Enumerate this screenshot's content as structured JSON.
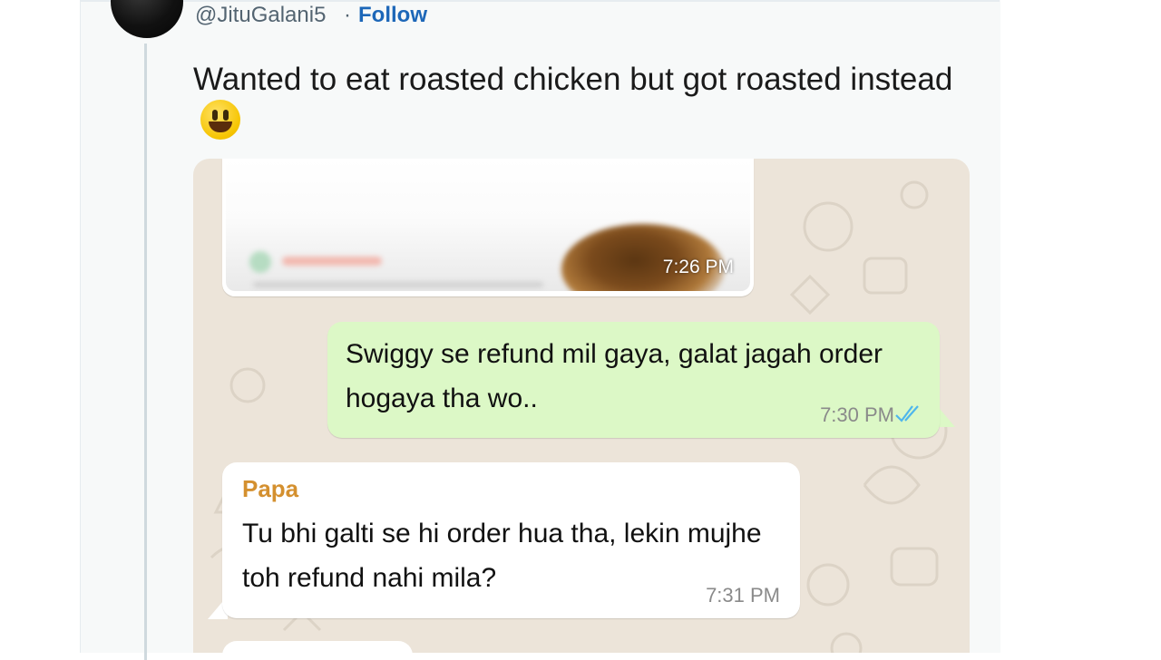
{
  "tweet": {
    "handle": "@JituGalani5",
    "separator": "·",
    "follow_label": "Follow",
    "text": "Wanted to eat roasted chicken but got roasted instead",
    "emoji": "grinning-face-emoji"
  },
  "chat": {
    "image_message": {
      "time": "7:26 PM"
    },
    "outgoing": {
      "text": "Swiggy se refund mil gaya, galat jagah order hogaya tha wo..",
      "time": "7:30 PM",
      "status_icon": "double-check-read-icon"
    },
    "incoming": {
      "sender": "Papa",
      "text": "Tu bhi galti se hi order hua tha, lekin mujhe toh refund nahi mila?",
      "time": "7:31 PM"
    }
  },
  "colors": {
    "follow": "#1d67b8",
    "outgoing_bubble": "#dcf8c6",
    "incoming_bubble": "#ffffff",
    "chat_background": "#ece4d9",
    "sender_name": "#d4902f",
    "read_ticks": "#4fb6ec"
  }
}
